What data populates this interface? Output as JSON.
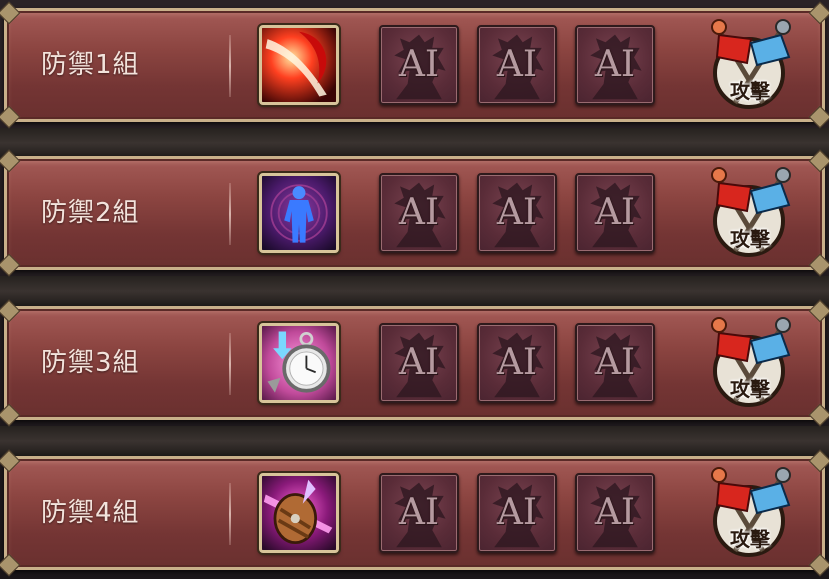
{
  "groups": [
    {
      "label": "防禦1組",
      "skill_icon": "flame-slash-icon",
      "ai_slots": [
        "AI",
        "AI",
        "AI"
      ],
      "attack_label": "攻擊"
    },
    {
      "label": "防禦2組",
      "skill_icon": "blue-aura-body-icon",
      "ai_slots": [
        "AI",
        "AI",
        "AI"
      ],
      "attack_label": "攻擊"
    },
    {
      "label": "防禦3組",
      "skill_icon": "pocket-watch-icon",
      "ai_slots": [
        "AI",
        "AI",
        "AI"
      ],
      "attack_label": "攻擊"
    },
    {
      "label": "防禦4組",
      "skill_icon": "shield-strike-icon",
      "ai_slots": [
        "AI",
        "AI",
        "AI"
      ],
      "attack_label": "攻擊"
    }
  ],
  "colors": {
    "panel": "#8c4541",
    "border": "#c9b08a",
    "ai_slot": "#5a2c38",
    "label": "#f3e3dc"
  }
}
